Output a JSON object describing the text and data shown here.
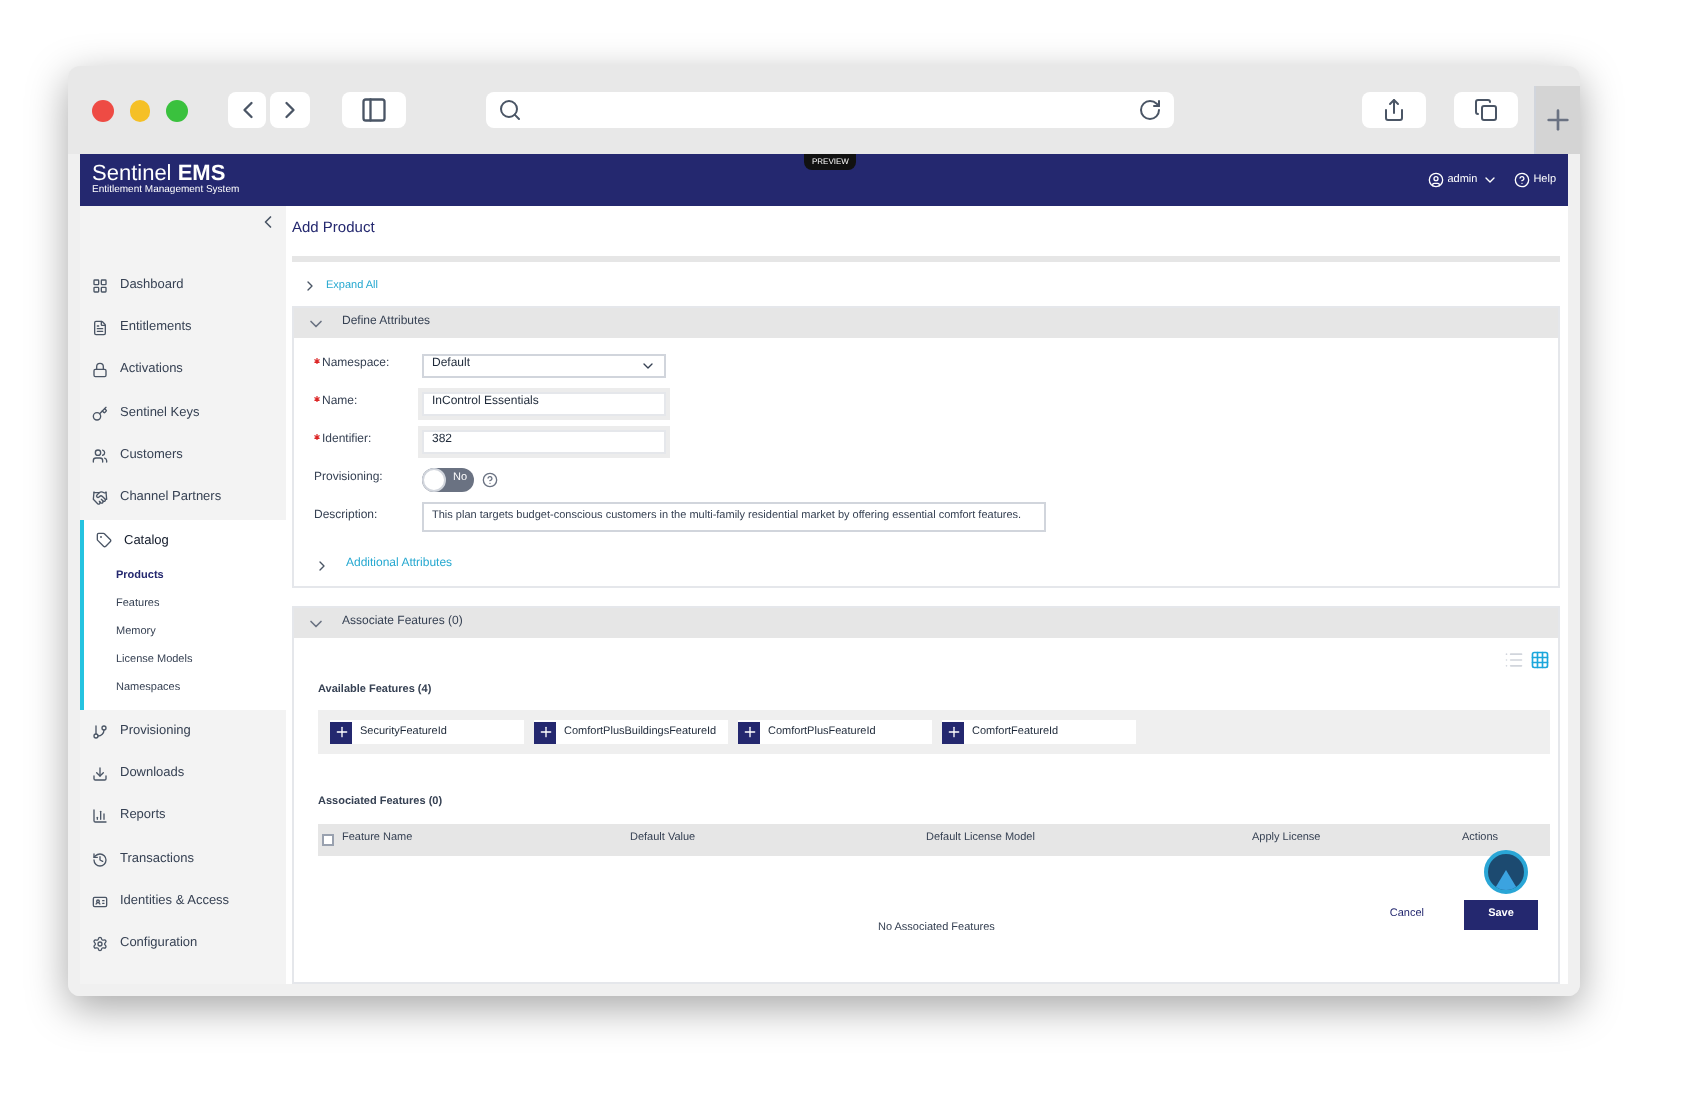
{
  "header": {
    "brand": "Sentinel **EMS**",
    "subtitle": "Entitlement Management System",
    "badge": "PREVIEW",
    "user": "admin",
    "help": "Help"
  },
  "sidebar": {
    "items": [
      {
        "label": "Dashboard",
        "selected": false
      },
      {
        "label": "Entitlements",
        "selected": false
      },
      {
        "label": "Activations",
        "selected": false
      },
      {
        "label": "Sentinel Keys",
        "selected": false
      },
      {
        "label": "Customers",
        "selected": false
      },
      {
        "label": "Channel Partners",
        "selected": false
      },
      {
        "label": "Catalog",
        "selected": true,
        "children": [
          {
            "label": "Products",
            "selected": true
          },
          {
            "label": "Features",
            "selected": false
          },
          {
            "label": "Memory",
            "selected": false
          },
          {
            "label": "License Models",
            "selected": false
          },
          {
            "label": "Namespaces",
            "selected": false
          }
        ]
      },
      {
        "label": "Provisioning",
        "selected": false
      },
      {
        "label": "Downloads",
        "selected": false
      },
      {
        "label": "Reports",
        "selected": false
      },
      {
        "label": "Transactions",
        "selected": false
      },
      {
        "label": "Identities & Access",
        "selected": false
      },
      {
        "label": "Configuration",
        "selected": false
      }
    ]
  },
  "content": {
    "title": "Add Product",
    "expand_all": "Expand All",
    "define_attributes": {
      "title": "Define Attributes",
      "expanded": true,
      "fields": [
        {
          "kind": "select",
          "label": "Namespace:",
          "required": true,
          "value": "Default"
        },
        {
          "kind": "text",
          "label": "Name:",
          "required": true,
          "value": "InControl Essentials"
        },
        {
          "kind": "text",
          "label": "Identifier:",
          "required": true,
          "value": "382"
        },
        {
          "kind": "toggle",
          "label": "Provisioning:",
          "required": false,
          "on": false,
          "value": "No"
        },
        {
          "kind": "textarea",
          "label": "Description:",
          "required": false,
          "value": "This plan targets budget-conscious customers in the multi-family residential market by offering essential comfort features."
        }
      ],
      "additional": "Additional Attributes"
    },
    "associate_features": {
      "title": "Associate Features (0)",
      "expanded": true,
      "views": [
        {
          "kind": "list",
          "selected": false
        },
        {
          "kind": "grid",
          "selected": true
        }
      ],
      "available_title": "Available Features (4)",
      "available": [
        "SecurityFeatureId",
        "ComfortPlusBuildingsFeatureId",
        "ComfortPlusFeatureId",
        "ComfortFeatureId"
      ],
      "associated_title": "Associated Features (0)",
      "table": {
        "select_all_checked": false,
        "columns": [
          "Feature Name",
          "Default Value",
          "Default License Model",
          "Apply License",
          "Actions"
        ],
        "empty": "No Associated Features"
      }
    },
    "buttons": {
      "cancel": "Cancel",
      "save": "Save"
    }
  }
}
